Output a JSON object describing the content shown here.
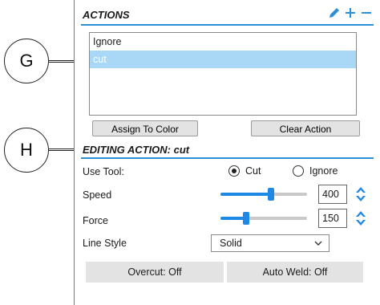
{
  "callouts": [
    {
      "letter": "G"
    },
    {
      "letter": "H"
    }
  ],
  "actions": {
    "title": "ACTIONS",
    "icons": [
      "pencil-icon",
      "plus-icon",
      "minus-icon"
    ],
    "items": [
      {
        "label": "Ignore",
        "selected": false
      },
      {
        "label": "cut",
        "selected": true
      }
    ],
    "assign_label": "Assign To Color",
    "clear_label": "Clear Action"
  },
  "editing": {
    "title": "EDITING ACTION: cut",
    "use_tool_label": "Use Tool:",
    "tool_options": [
      {
        "label": "Cut",
        "checked": true
      },
      {
        "label": "Ignore",
        "checked": false
      }
    ],
    "speed": {
      "label": "Speed",
      "value": "400",
      "level": 0.58
    },
    "force": {
      "label": "Force",
      "value": "150",
      "level": 0.3
    },
    "line_style": {
      "label": "Line Style",
      "value": "Solid"
    },
    "overcut_label": "Overcut: Off",
    "autoweld_label": "Auto Weld: Off"
  },
  "colors": {
    "accent": "#2b8fd6",
    "selection": "#a8d8f6",
    "slider": "#1e88e5"
  }
}
